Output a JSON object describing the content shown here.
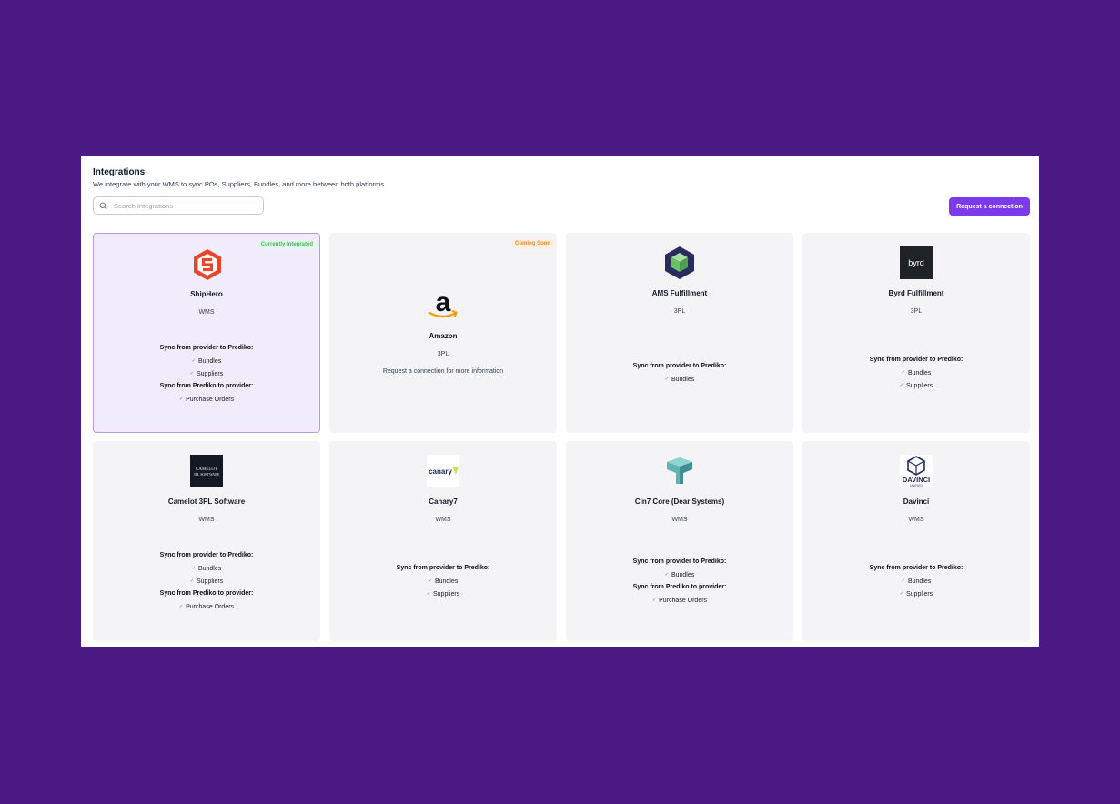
{
  "header": {
    "title": "Integrations",
    "subtitle": "We integrate with your WMS to sync POs, Suppliers, Bundles, and more between both platforms."
  },
  "search": {
    "placeholder": "Search Integrations",
    "value": ""
  },
  "actions": {
    "request_label": "Request a connection"
  },
  "colors": {
    "background": "#4b1a84",
    "accent": "#7c3aed",
    "integrated": "#3fbf62",
    "coming_soon": "#ef8a2a"
  },
  "cards": [
    {
      "name": "ShipHero",
      "type": "WMS",
      "badge": "Currently Integrated",
      "icon": "shiphero-logo",
      "sync_to_prediko_label": "Sync from provider to Prediko:",
      "sync_to_prediko": [
        "Bundles",
        "Suppliers"
      ],
      "sync_to_provider_label": "Sync from Prediko to provider:",
      "sync_to_provider": [
        "Purchase Orders"
      ]
    },
    {
      "name": "Amazon",
      "type": "3PL",
      "badge": "Coming Soon",
      "icon": "amazon-logo",
      "note": "Request a connection for more information"
    },
    {
      "name": "AMS Fulfillment",
      "type": "3PL",
      "icon": "ams-fulfillment-logo",
      "sync_to_prediko_label": "Sync from provider to Prediko:",
      "sync_to_prediko": [
        "Bundles"
      ]
    },
    {
      "name": "Byrd Fulfillment",
      "type": "3PL",
      "icon": "byrd-logo",
      "logo_text": "byrd",
      "sync_to_prediko_label": "Sync from provider to Prediko:",
      "sync_to_prediko": [
        "Bundles",
        "Suppliers"
      ]
    },
    {
      "name": "Camelot 3PL Software",
      "type": "WMS",
      "icon": "camelot-logo",
      "logo_text": "CAMELOT 3PL SOFTWARE",
      "sync_to_prediko_label": "Sync from provider to Prediko:",
      "sync_to_prediko": [
        "Bundles",
        "Suppliers"
      ],
      "sync_to_provider_label": "Sync from Prediko to provider:",
      "sync_to_provider": [
        "Purchase Orders"
      ]
    },
    {
      "name": "Canary7",
      "type": "WMS",
      "icon": "canary7-logo",
      "logo_text": "canary7",
      "sync_to_prediko_label": "Sync from provider to Prediko:",
      "sync_to_prediko": [
        "Bundles",
        "Suppliers"
      ]
    },
    {
      "name": "Cin7 Core (Dear Systems)",
      "type": "WMS",
      "icon": "cin7-logo",
      "sync_to_prediko_label": "Sync from provider to Prediko:",
      "sync_to_prediko": [
        "Bundles"
      ],
      "sync_to_provider_label": "Sync from Prediko to provider:",
      "sync_to_provider": [
        "Purchase Orders"
      ]
    },
    {
      "name": "Davinci",
      "type": "WMS",
      "icon": "davinci-logo",
      "logo_text": "DAVINCI UNIFIED",
      "sync_to_prediko_label": "Sync from provider to Prediko:",
      "sync_to_prediko": [
        "Bundles",
        "Suppliers"
      ]
    }
  ]
}
